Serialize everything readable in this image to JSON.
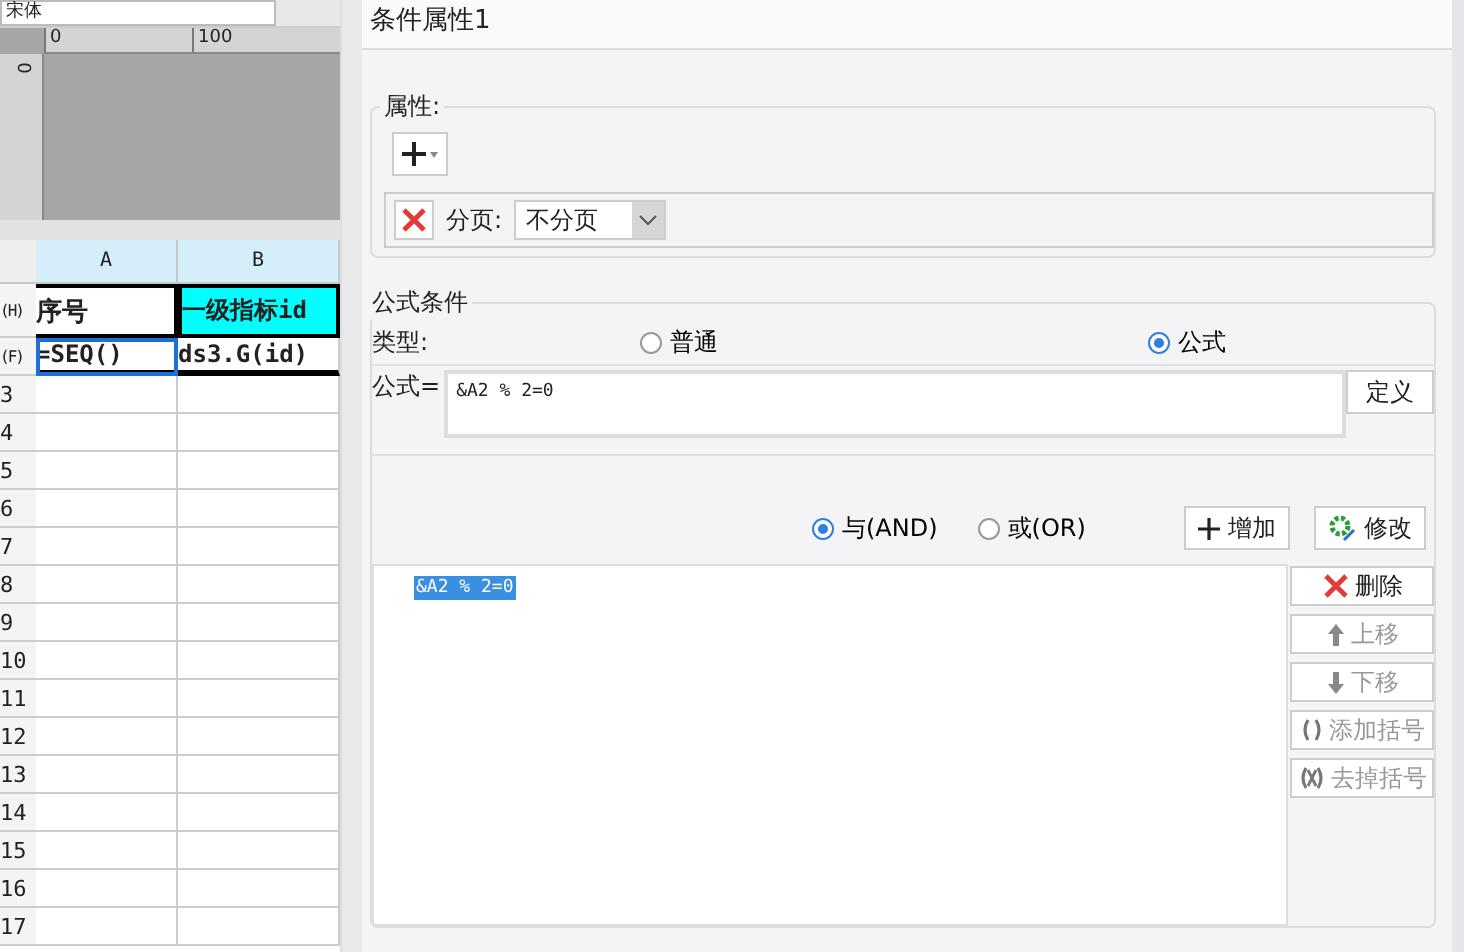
{
  "font_box": {
    "value": "宋体"
  },
  "ruler": {
    "x_labels": [
      "0",
      "100"
    ],
    "y_labels": [
      "0"
    ]
  },
  "sheet": {
    "columns": [
      "A",
      "B"
    ],
    "rows": [
      {
        "header": "(H)",
        "cells": [
          {
            "text": "序号",
            "kind": "header",
            "selected": false
          },
          {
            "text": "一级指标id",
            "kind": "highlight",
            "selected": false
          }
        ]
      },
      {
        "header": "(F)",
        "cells": [
          {
            "text": "=SEQ()",
            "kind": "formula",
            "selected": true
          },
          {
            "text": "ds3.G(id)",
            "kind": "formula",
            "selected": false
          }
        ]
      },
      {
        "header": "3",
        "cells": []
      },
      {
        "header": "4",
        "cells": []
      },
      {
        "header": "5",
        "cells": []
      },
      {
        "header": "6",
        "cells": []
      },
      {
        "header": "7",
        "cells": []
      },
      {
        "header": "8",
        "cells": []
      },
      {
        "header": "9",
        "cells": []
      },
      {
        "header": "10",
        "cells": []
      },
      {
        "header": "11",
        "cells": []
      },
      {
        "header": "12",
        "cells": []
      },
      {
        "header": "13",
        "cells": []
      },
      {
        "header": "14",
        "cells": []
      },
      {
        "header": "15",
        "cells": []
      },
      {
        "header": "16",
        "cells": []
      },
      {
        "header": "17",
        "cells": []
      }
    ]
  },
  "dialog": {
    "title": "条件属性1",
    "properties": {
      "legend": "属性:",
      "page_label": "分页:",
      "page_value": "不分页"
    },
    "formula_condition": {
      "legend": "公式条件",
      "type_label": "类型:",
      "types": [
        {
          "label": "普通",
          "selected": false
        },
        {
          "label": "公式",
          "selected": true
        }
      ],
      "formula_label": "公式=",
      "formula_value": "&A2 % 2=0",
      "define_button": "定义",
      "logic": [
        {
          "label": "与(AND)",
          "selected": true
        },
        {
          "label": "或(OR)",
          "selected": false
        }
      ],
      "add_button": "增加",
      "modify_button": "修改",
      "conditions": [
        {
          "text": "&A2 % 2=0",
          "selected": true
        }
      ],
      "side_buttons": [
        {
          "label": "删除",
          "kind": "delete",
          "disabled": false
        },
        {
          "label": "上移",
          "kind": "up",
          "disabled": true
        },
        {
          "label": "下移",
          "kind": "down",
          "disabled": true
        },
        {
          "label": "添加括号",
          "kind": "paren-add",
          "disabled": true
        },
        {
          "label": "去掉括号",
          "kind": "paren-remove",
          "disabled": true
        }
      ]
    }
  }
}
